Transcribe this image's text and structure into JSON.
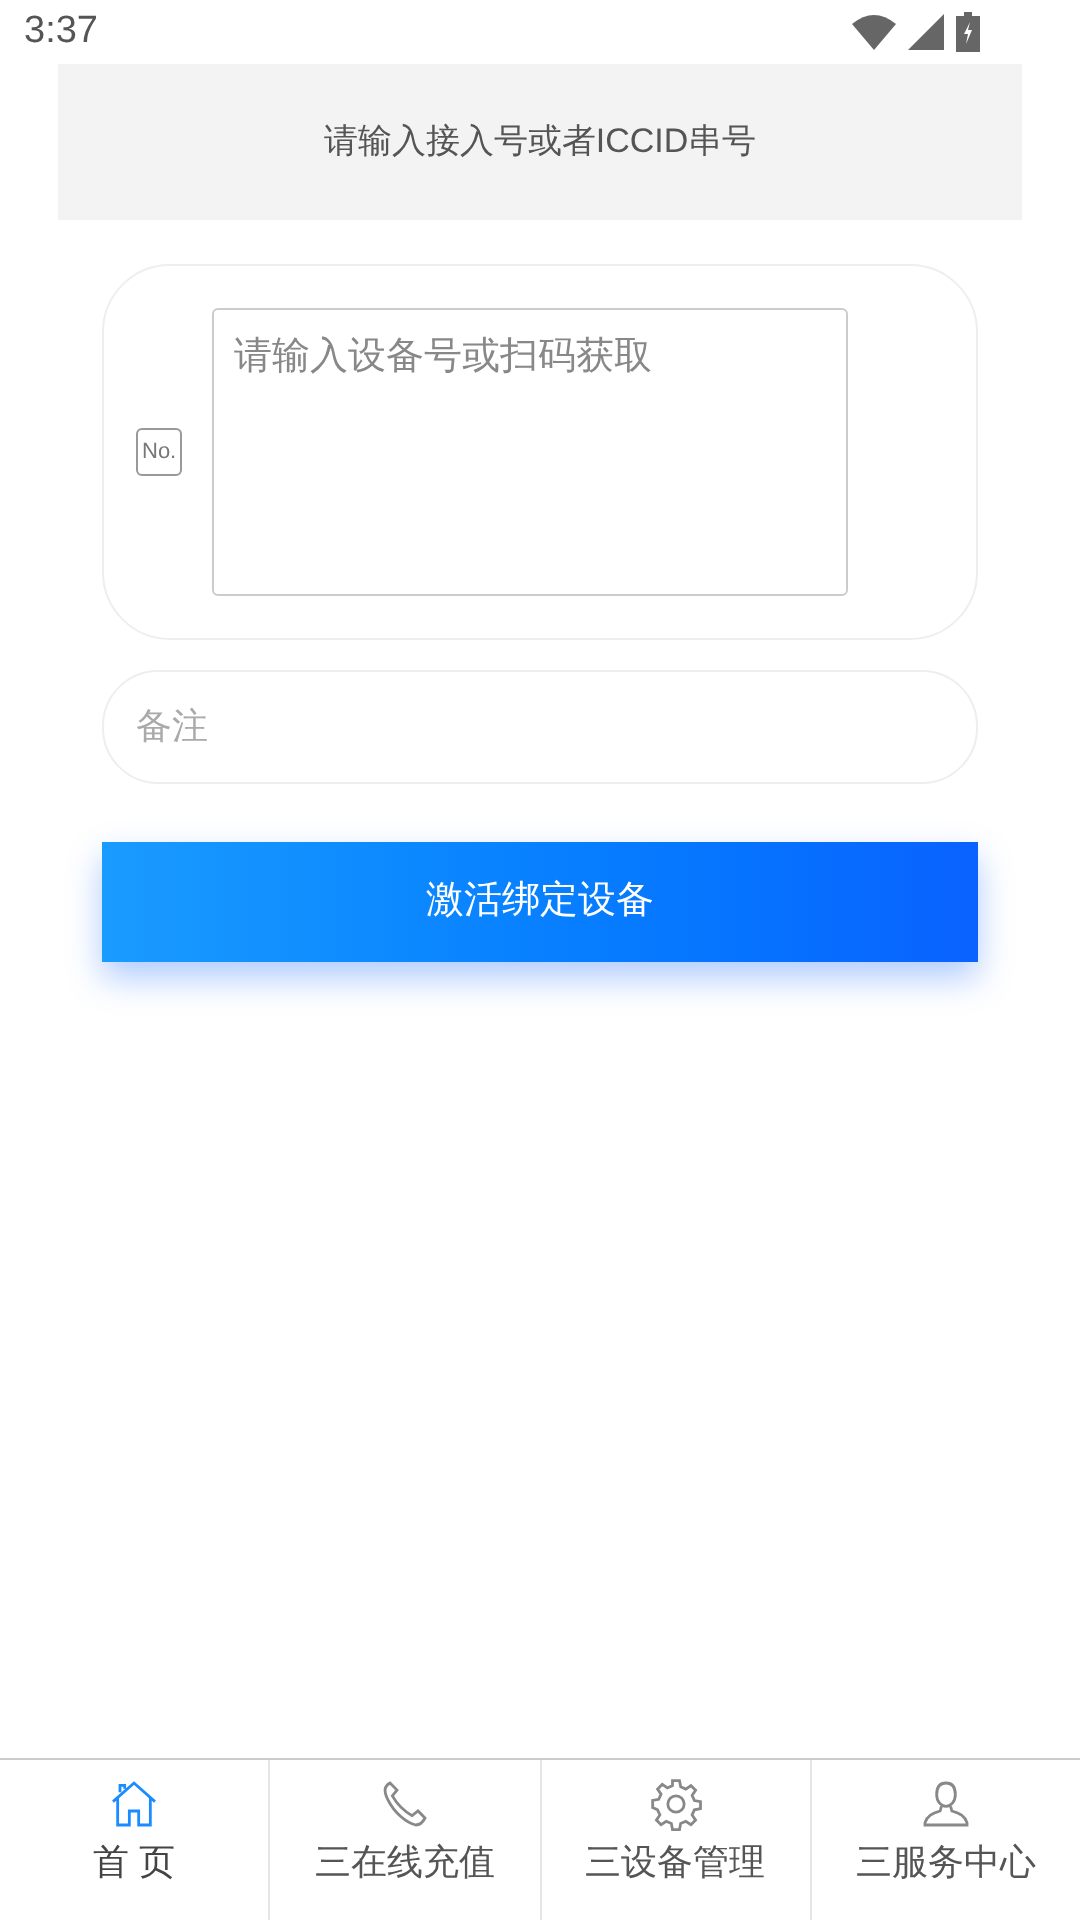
{
  "status_bar": {
    "time": "3:37"
  },
  "iccid_banner": {
    "text": "请输入接入号或者ICCID串号"
  },
  "device_field": {
    "badge": "No.",
    "placeholder": "请输入设备号或扫码获取"
  },
  "remark_field": {
    "placeholder": "备注"
  },
  "activate_button": {
    "label": "激活绑定设备"
  },
  "tabs": [
    {
      "kind": "home",
      "label": "首 页",
      "selected": true
    },
    {
      "kind": "phone",
      "label": "三在线充值",
      "selected": false
    },
    {
      "kind": "gear",
      "label": "三设备管理",
      "selected": false
    },
    {
      "kind": "user",
      "label": "三服务中心",
      "selected": false
    }
  ]
}
